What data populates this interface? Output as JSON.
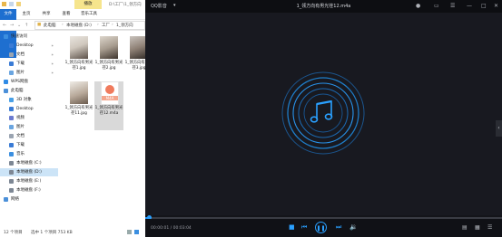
{
  "explorer": {
    "ribbon_tabs": [
      "文件",
      "主页",
      "共享",
      "查看",
      "音乐工具"
    ],
    "context_tab": "播放",
    "window_title": "D:\\工厂\\1_领方向",
    "address_crumbs": [
      "此电脑",
      "本地磁盘 (D:)",
      "工厂",
      "1_领方向"
    ],
    "nav": [
      {
        "label": "快速访问",
        "icon": "star-icon",
        "color": "#3b8fe0"
      },
      {
        "label": "Desktop",
        "icon": "desktop-icon",
        "color": "#3a7bd5",
        "pinned": true
      },
      {
        "label": "文档",
        "icon": "documents-icon",
        "color": "#9aa4b1",
        "pinned": true
      },
      {
        "label": "下载",
        "icon": "download-icon",
        "color": "#3a7bd5",
        "pinned": true
      },
      {
        "label": "图片",
        "icon": "pictures-icon",
        "color": "#6aa5e0",
        "pinned": true
      },
      {
        "label": "WPS网盘",
        "icon": "cloud-icon",
        "color": "#2f8be6"
      },
      {
        "label": "此电脑",
        "icon": "computer-icon",
        "color": "#4b90d9"
      },
      {
        "label": "3D 对象",
        "icon": "3d-objects-icon",
        "color": "#49a0e6"
      },
      {
        "label": "Desktop",
        "icon": "desktop-icon",
        "color": "#3a7bd5"
      },
      {
        "label": "视频",
        "icon": "video-icon",
        "color": "#6b7bd0"
      },
      {
        "label": "图片",
        "icon": "pictures-icon",
        "color": "#6aa5e0"
      },
      {
        "label": "文档",
        "icon": "documents-icon",
        "color": "#9aa4b1"
      },
      {
        "label": "下载",
        "icon": "download-icon",
        "color": "#3a7bd5"
      },
      {
        "label": "音乐",
        "icon": "music-icon",
        "color": "#3b8fe0"
      },
      {
        "label": "本地磁盘 (C:)",
        "icon": "drive-icon",
        "color": "#7d8794"
      },
      {
        "label": "本地磁盘 (D:)",
        "icon": "drive-icon",
        "color": "#7d8794",
        "selected": true
      },
      {
        "label": "本地磁盘 (E:)",
        "icon": "drive-icon",
        "color": "#7d8794"
      },
      {
        "label": "本地磁盘 (F:)",
        "icon": "drive-icon",
        "color": "#7d8794"
      },
      {
        "label": "网络",
        "icon": "network-icon",
        "color": "#4b90d9"
      }
    ],
    "files": [
      {
        "name": "1_领方向有男光荏1.jpg",
        "kind": "photo",
        "tone": "ph1"
      },
      {
        "name": "1_领方向有男光荏2.jpg",
        "kind": "photo",
        "tone": "ph2"
      },
      {
        "name": "1_领方向有男光荏3.jpg",
        "kind": "photo",
        "tone": "ph3"
      },
      {
        "name": "1_领方向有男光荏11.jpg",
        "kind": "photo",
        "tone": "ph4"
      },
      {
        "name": "1_领方向有男光荏12.m4a",
        "kind": "audio",
        "badge": "M4A",
        "selected": true
      }
    ],
    "status": {
      "count": "12 个项目",
      "selected": "选中 1 个项目  753 KB"
    }
  },
  "player": {
    "app_name": "QQ影音",
    "title": "1_领方向有男光荏12.m4a",
    "time": "00:00:01 / 00:03:04",
    "progress": 0.005,
    "accent": "#2aa0ff"
  }
}
